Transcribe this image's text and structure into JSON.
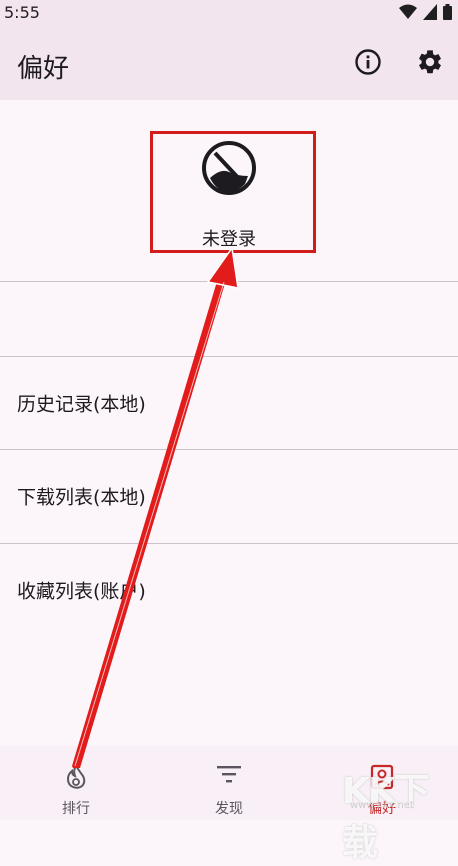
{
  "status": {
    "time": "5:55"
  },
  "app_bar": {
    "title": "偏好"
  },
  "login": {
    "label": "未登录"
  },
  "menu": [
    {
      "label": "历史记录(本地)"
    },
    {
      "label": "下载列表(本地)"
    },
    {
      "label": "收藏列表(账户)"
    }
  ],
  "bottom_nav": [
    {
      "label": "排行",
      "icon": "fire-icon"
    },
    {
      "label": "发现",
      "icon": "filter-icon"
    },
    {
      "label": "偏好",
      "icon": "portrait-icon",
      "active": true
    }
  ],
  "colors": {
    "accent": "#c62828",
    "highlight": "#d21c1c",
    "app_bar_bg": "#f3e5ee",
    "page_bg": "#fcf6fb"
  },
  "watermark": {
    "text": "KK下载",
    "sub": "www.kkx.net"
  }
}
